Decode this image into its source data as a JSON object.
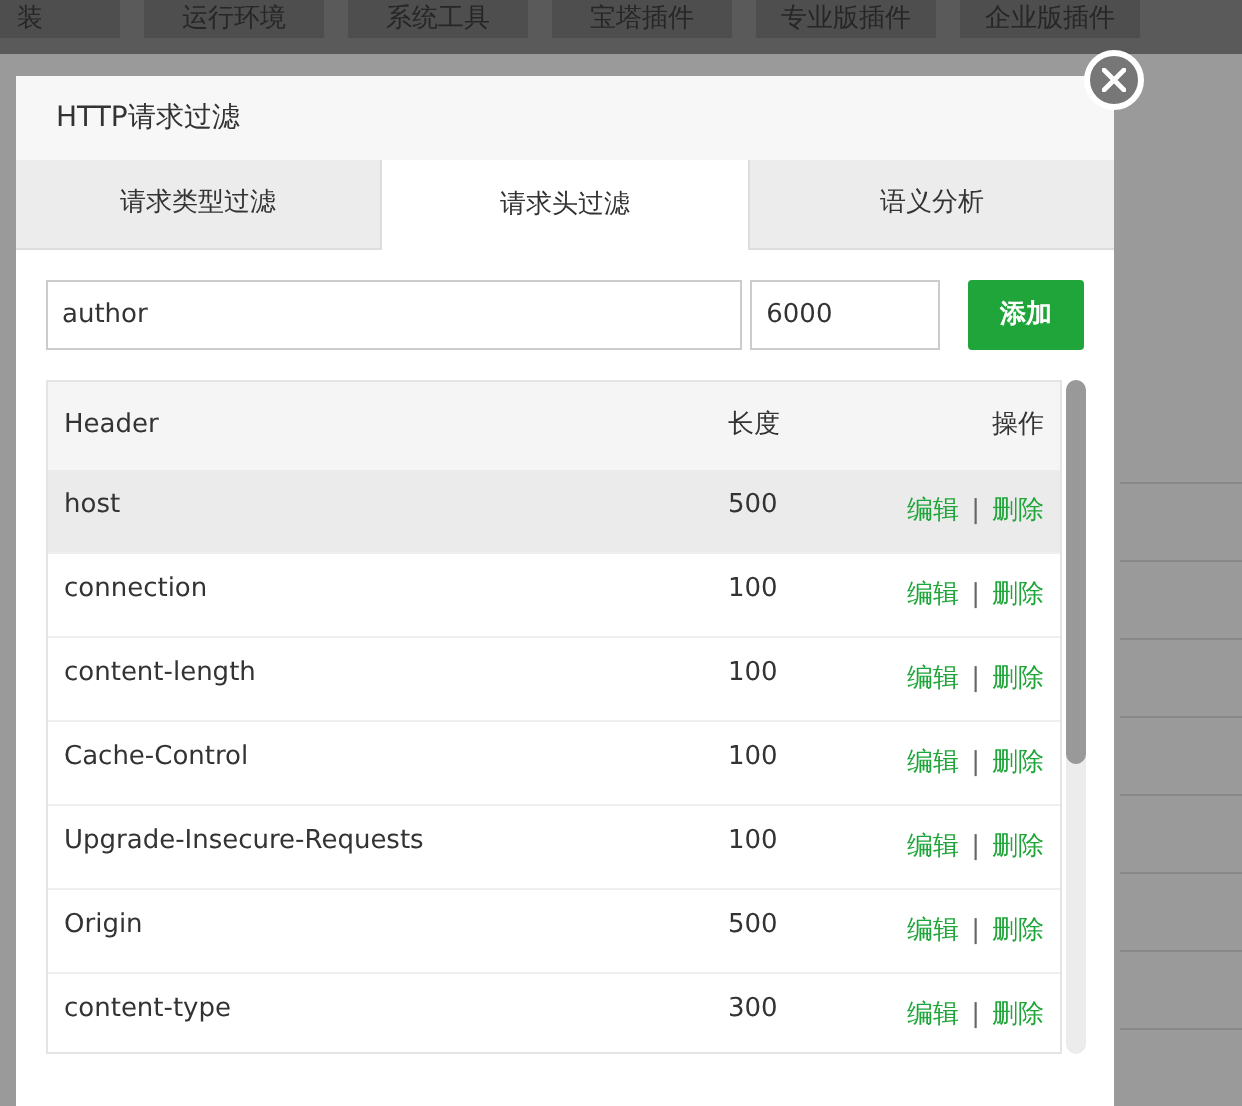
{
  "background": {
    "nav_items": [
      "装",
      "运行环境",
      "系统工具",
      "宝塔插件",
      "专业版插件",
      "企业版插件"
    ]
  },
  "dialog": {
    "title": "HTTP请求过滤",
    "tabs": [
      {
        "label": "请求类型过滤",
        "selected": false
      },
      {
        "label": "请求头过滤",
        "selected": true
      },
      {
        "label": "语义分析",
        "selected": false
      }
    ],
    "form": {
      "header_value": "author",
      "length_value": "6000",
      "add_button": "添加"
    },
    "table": {
      "columns": [
        "Header",
        "长度",
        "操作"
      ],
      "rows": [
        {
          "header": "host",
          "length": "500",
          "edit": "编辑",
          "separator": "|",
          "delete": "删除",
          "hovered": true
        },
        {
          "header": "connection",
          "length": "100",
          "edit": "编辑",
          "separator": "|",
          "delete": "删除",
          "hovered": false
        },
        {
          "header": "content-length",
          "length": "100",
          "edit": "编辑",
          "separator": "|",
          "delete": "删除",
          "hovered": false
        },
        {
          "header": "Cache-Control",
          "length": "100",
          "edit": "编辑",
          "separator": "|",
          "delete": "删除",
          "hovered": false
        },
        {
          "header": "Upgrade-Insecure-Requests",
          "length": "100",
          "edit": "编辑",
          "separator": "|",
          "delete": "删除",
          "hovered": false
        },
        {
          "header": "Origin",
          "length": "500",
          "edit": "编辑",
          "separator": "|",
          "delete": "删除",
          "hovered": false
        },
        {
          "header": "content-type",
          "length": "300",
          "edit": "编辑",
          "separator": "|",
          "delete": "删除",
          "hovered": false
        }
      ]
    }
  }
}
